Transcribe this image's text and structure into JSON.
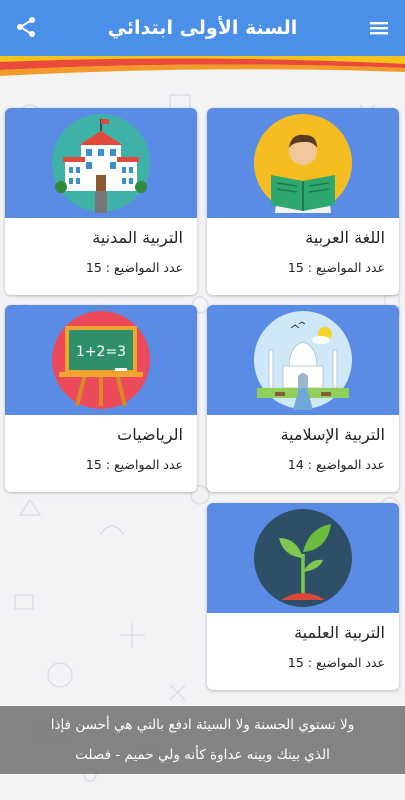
{
  "header": {
    "title": "السنة الأولى ابتدائي",
    "menu_icon": "hamburger-menu-icon",
    "share_icon": "share-icon",
    "color": "#4a8fe8"
  },
  "subjects": [
    {
      "name": "اللغة العربية",
      "count": "عدد المواضيع : 15",
      "icon": "reading-boy-icon"
    },
    {
      "name": "التربية المدنية",
      "count": "عدد المواضيع : 15",
      "icon": "school-building-icon"
    },
    {
      "name": "التربية الإسلامية",
      "count": "عدد المواضيع : 14",
      "icon": "mosque-icon"
    },
    {
      "name": "الرياضيات",
      "count": "عدد المواضيع : 15",
      "icon": "chalkboard-icon"
    },
    {
      "name": "التربية العلمية",
      "count": "عدد المواضيع : 15",
      "icon": "plant-sprout-icon"
    }
  ],
  "quote": {
    "line1": "ولا تستوي الحسنة ولا السيئة ادفع بالتي هي أحسن فإذا",
    "line2": "الذي بينك وبينه عداوة كأنه ولي حميم - فصلت"
  },
  "colors": {
    "card_image_bg": "#5a8ce6",
    "stripe_yellow": "#f6c21c",
    "stripe_red": "#e94a3c",
    "stripe_orange": "#f29a2a"
  }
}
